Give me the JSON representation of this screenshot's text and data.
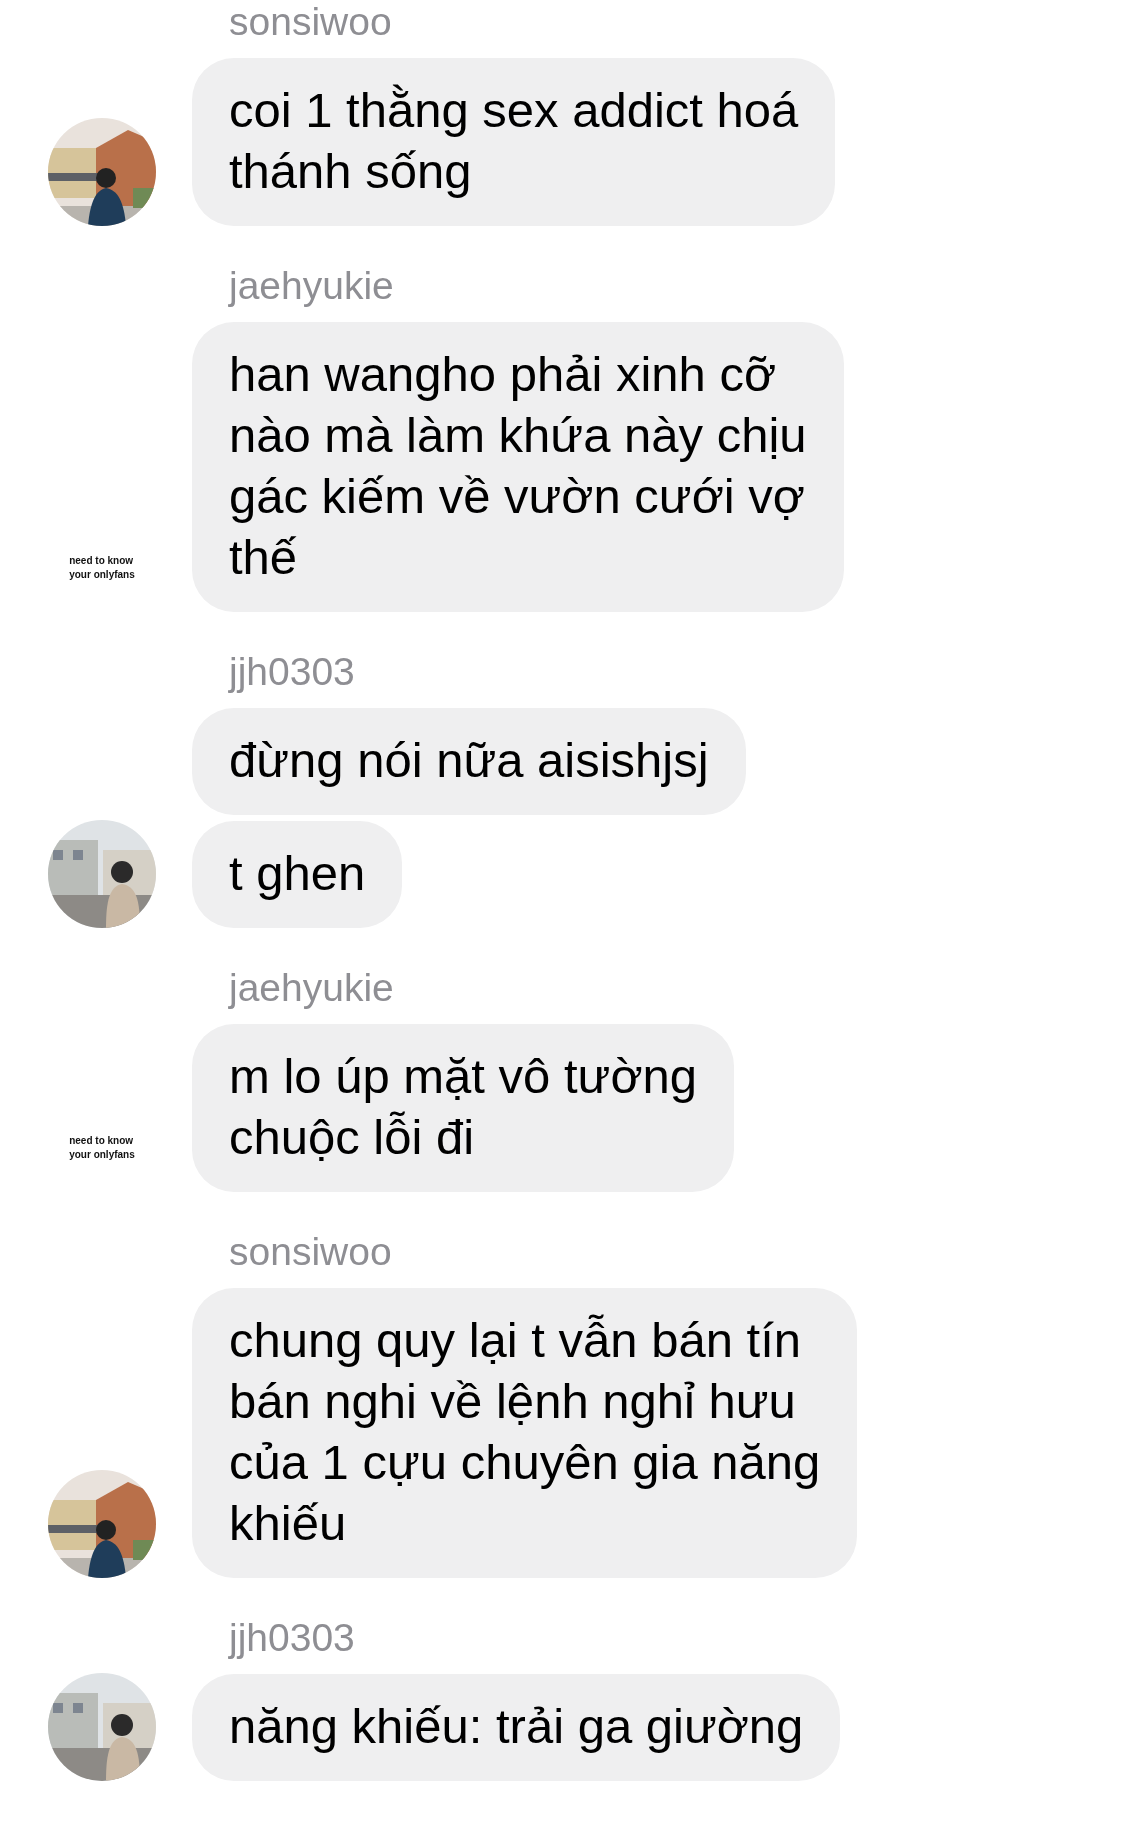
{
  "groups": [
    {
      "sender": "sonsiwoo",
      "avatar": {
        "kind": "picture"
      },
      "messages": [
        "coi 1 thằng sex addict hoá\nthánh sống"
      ]
    },
    {
      "sender": "jaehyukie",
      "avatar": {
        "kind": "text",
        "caption": "need to know\nyour onlyfans"
      },
      "messages": [
        "han wangho phải xinh cỡ\nnào mà làm khứa này chịu\ngác kiếm về vườn cưới vợ\nthế"
      ]
    },
    {
      "sender": "jjh0303",
      "avatar": {
        "kind": "picture"
      },
      "messages": [
        "đừng nói nữa aisishjsj",
        "t ghen"
      ]
    },
    {
      "sender": "jaehyukie",
      "avatar": {
        "kind": "text",
        "caption": "need to know\nyour onlyfans"
      },
      "messages": [
        "m lo úp mặt vô tường\nchuộc lỗi đi"
      ]
    },
    {
      "sender": "sonsiwoo",
      "avatar": {
        "kind": "picture"
      },
      "messages": [
        "chung quy lại t vẫn bán tín\nbán nghi về lệnh nghỉ hưu\ncủa 1 cựu chuyên gia năng\nkhiếu"
      ]
    },
    {
      "sender": "jjh0303",
      "avatar": {
        "kind": "picture"
      },
      "messages": [
        "năng khiếu: trải ga giường"
      ]
    }
  ]
}
